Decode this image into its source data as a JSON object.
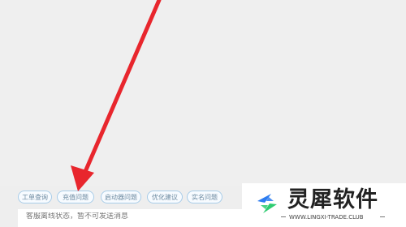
{
  "quick_replies": [
    "工单查询",
    "充值问题",
    "启动器问题",
    "优化建议",
    "实名问题"
  ],
  "input": {
    "placeholder": "客服离线状态，暂不可发送消息"
  },
  "annotation": {
    "arrow_color": "#e8262d",
    "arrow_icon": "red-arrow-icon"
  },
  "watermark": {
    "title": "灵犀软件",
    "url": "WWW.LINGXI-TRADE.CLUB",
    "logo_icon": "lingxi-logo-icon",
    "logo_colors": [
      "#2d7cf0",
      "#2ecc71"
    ]
  }
}
